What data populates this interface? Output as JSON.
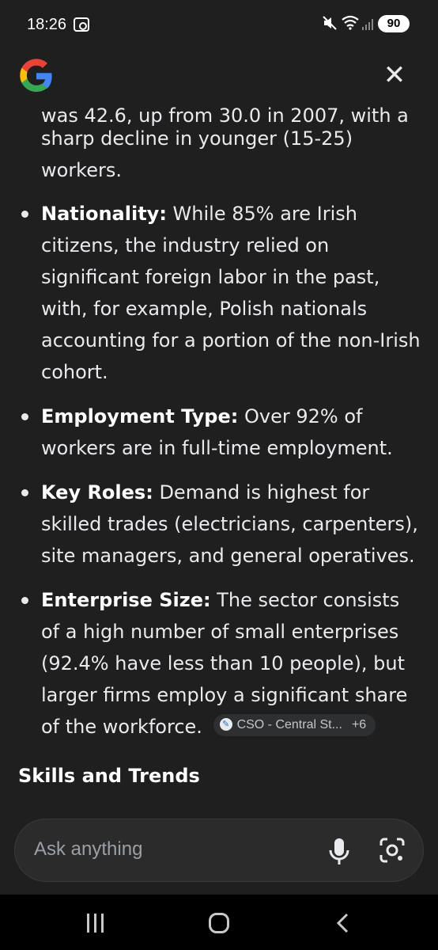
{
  "status_bar": {
    "time": "18:26",
    "battery": "90",
    "icons": [
      "screen-record-icon",
      "mute-icon",
      "wifi-icon",
      "signal-icon",
      "battery-icon"
    ]
  },
  "header": {
    "logo": "google-g-logo",
    "close_label": "✕"
  },
  "content": {
    "cut_line": "was 42.6, up from 30.0 in 2007, with a",
    "prev_paragraph_end": "sharp decline in younger (15-25) workers.",
    "bullets": [
      {
        "label": "Nationality:",
        "text": " While 85% are Irish citizens, the industry relied on significant foreign labor in the past, with, for example, Polish nationals accounting for a portion of the non-Irish cohort."
      },
      {
        "label": "Employment Type:",
        "text": " Over 92% of workers are in full-time employment."
      },
      {
        "label": "Key Roles:",
        "text": " Demand is highest for skilled trades (electricians, carpenters), site managers, and general operatives."
      },
      {
        "label": "Enterprise Size:",
        "text": " The sector consists of a high number of small enterprises (92.4% have less than 10 people), but larger firms employ a significant share of the workforce."
      }
    ],
    "source_chip": {
      "label": "CSO - Central St...",
      "count": "+6"
    },
    "section_heading": "Skills and Trends"
  },
  "ask_bar": {
    "placeholder": "Ask anything"
  },
  "colors": {
    "background": "#1f1f1f",
    "text": "#e8eaed",
    "chip_bg": "#2d2f31",
    "ask_bg": "#2b2b2b"
  }
}
